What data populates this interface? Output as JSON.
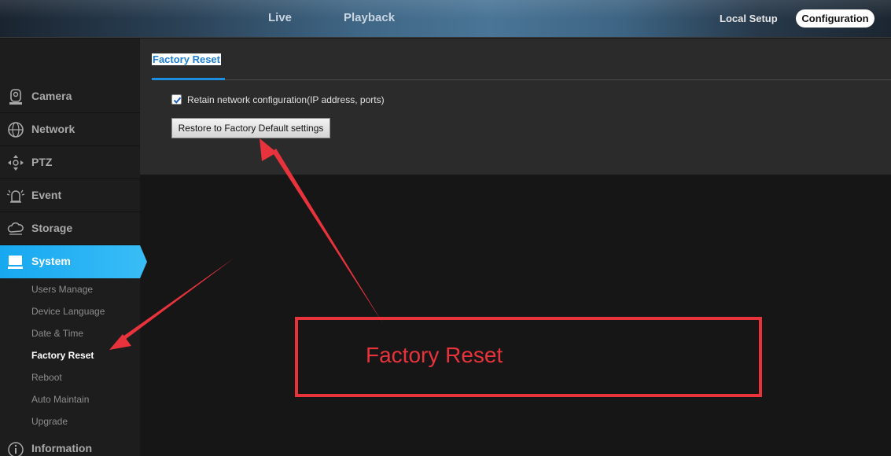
{
  "topbar": {
    "live": "Live",
    "playback": "Playback",
    "local_setup": "Local Setup",
    "configuration": "Configuration"
  },
  "sidebar": {
    "items": [
      {
        "label": "Camera",
        "icon": "camera-icon"
      },
      {
        "label": "Network",
        "icon": "globe-icon"
      },
      {
        "label": "PTZ",
        "icon": "ptz-icon"
      },
      {
        "label": "Event",
        "icon": "alarm-icon"
      },
      {
        "label": "Storage",
        "icon": "cloud-icon"
      },
      {
        "label": "System",
        "icon": "monitor-icon",
        "active": true
      },
      {
        "label": "Information",
        "icon": "info-icon"
      }
    ],
    "system_sub": [
      "Users Manage",
      "Device Language",
      "Date & Time",
      "Factory Reset",
      "Reboot",
      "Auto Maintain",
      "Upgrade"
    ],
    "current_sub": "Factory Reset"
  },
  "main": {
    "tab_title": "Factory Reset",
    "retain_label": "Retain network configuration(IP address, ports)",
    "retain_checked": true,
    "restore_button": "Restore to Factory Default settings"
  },
  "annotation": {
    "text": "Factory Reset",
    "color": "#e8333c"
  },
  "colors": {
    "accent": "#1e8fe0",
    "active_menu": "#2bb4f5"
  }
}
